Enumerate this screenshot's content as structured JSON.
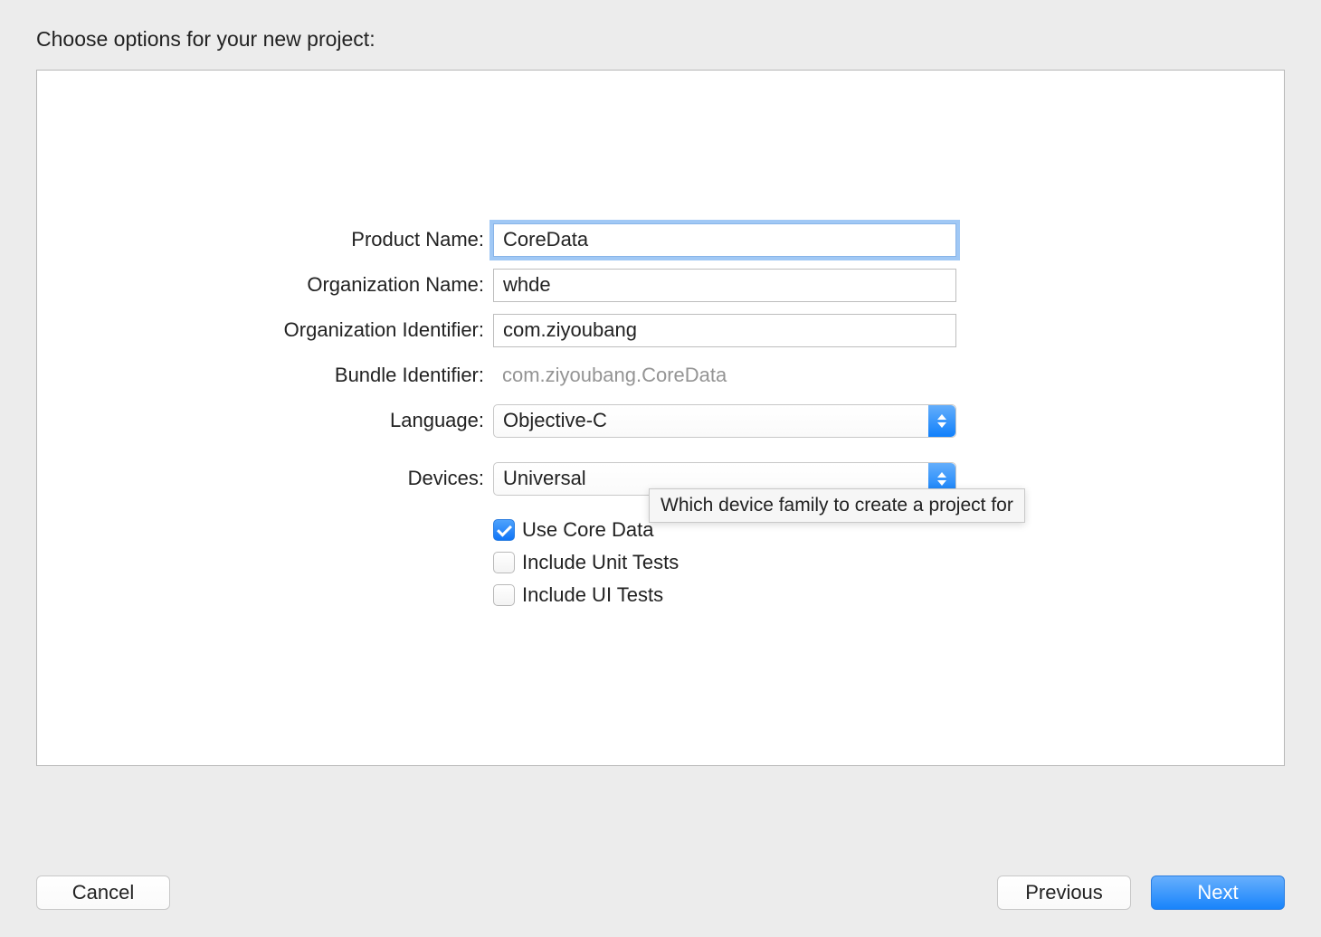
{
  "header": {
    "title": "Choose options for your new project:"
  },
  "form": {
    "product_name": {
      "label": "Product Name:",
      "value": "CoreData"
    },
    "organization_name": {
      "label": "Organization Name:",
      "value": "whde"
    },
    "organization_identifier": {
      "label": "Organization Identifier:",
      "value": "com.ziyoubang"
    },
    "bundle_identifier": {
      "label": "Bundle Identifier:",
      "value": "com.ziyoubang.CoreData"
    },
    "language": {
      "label": "Language:",
      "value": "Objective-C"
    },
    "devices": {
      "label": "Devices:",
      "value": "Universal",
      "tooltip": "Which device family to create a project for"
    },
    "checkboxes": {
      "core_data": {
        "label": "Use Core Data",
        "checked": true
      },
      "unit_tests": {
        "label": "Include Unit Tests",
        "checked": false
      },
      "ui_tests": {
        "label": "Include UI Tests",
        "checked": false
      }
    }
  },
  "buttons": {
    "cancel": "Cancel",
    "previous": "Previous",
    "next": "Next"
  }
}
